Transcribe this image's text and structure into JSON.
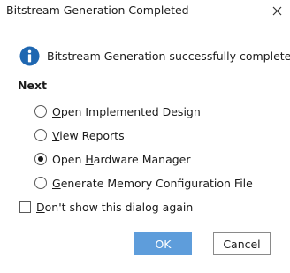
{
  "window": {
    "title": "Bitstream Generation Completed",
    "close_icon": "close-icon"
  },
  "message": {
    "icon": "info-icon",
    "text": "Bitstream Generation successfully completed."
  },
  "next": {
    "label": "Next",
    "options": [
      {
        "mnemonic": "O",
        "rest": "pen Implemented Design",
        "selected": false
      },
      {
        "mnemonic": "V",
        "rest": "iew Reports",
        "selected": false
      },
      {
        "pre": "Open ",
        "mnemonic": "H",
        "rest": "ardware Manager",
        "selected": true
      },
      {
        "mnemonic": "G",
        "rest": "enerate Memory Configuration File",
        "selected": false
      }
    ]
  },
  "dont_show": {
    "mnemonic": "D",
    "rest": "on't show this dialog again",
    "checked": false
  },
  "buttons": {
    "ok": "OK",
    "cancel": "Cancel"
  },
  "colors": {
    "ok_button": "#5e9ddb",
    "info_icon": "#1f67b1"
  }
}
